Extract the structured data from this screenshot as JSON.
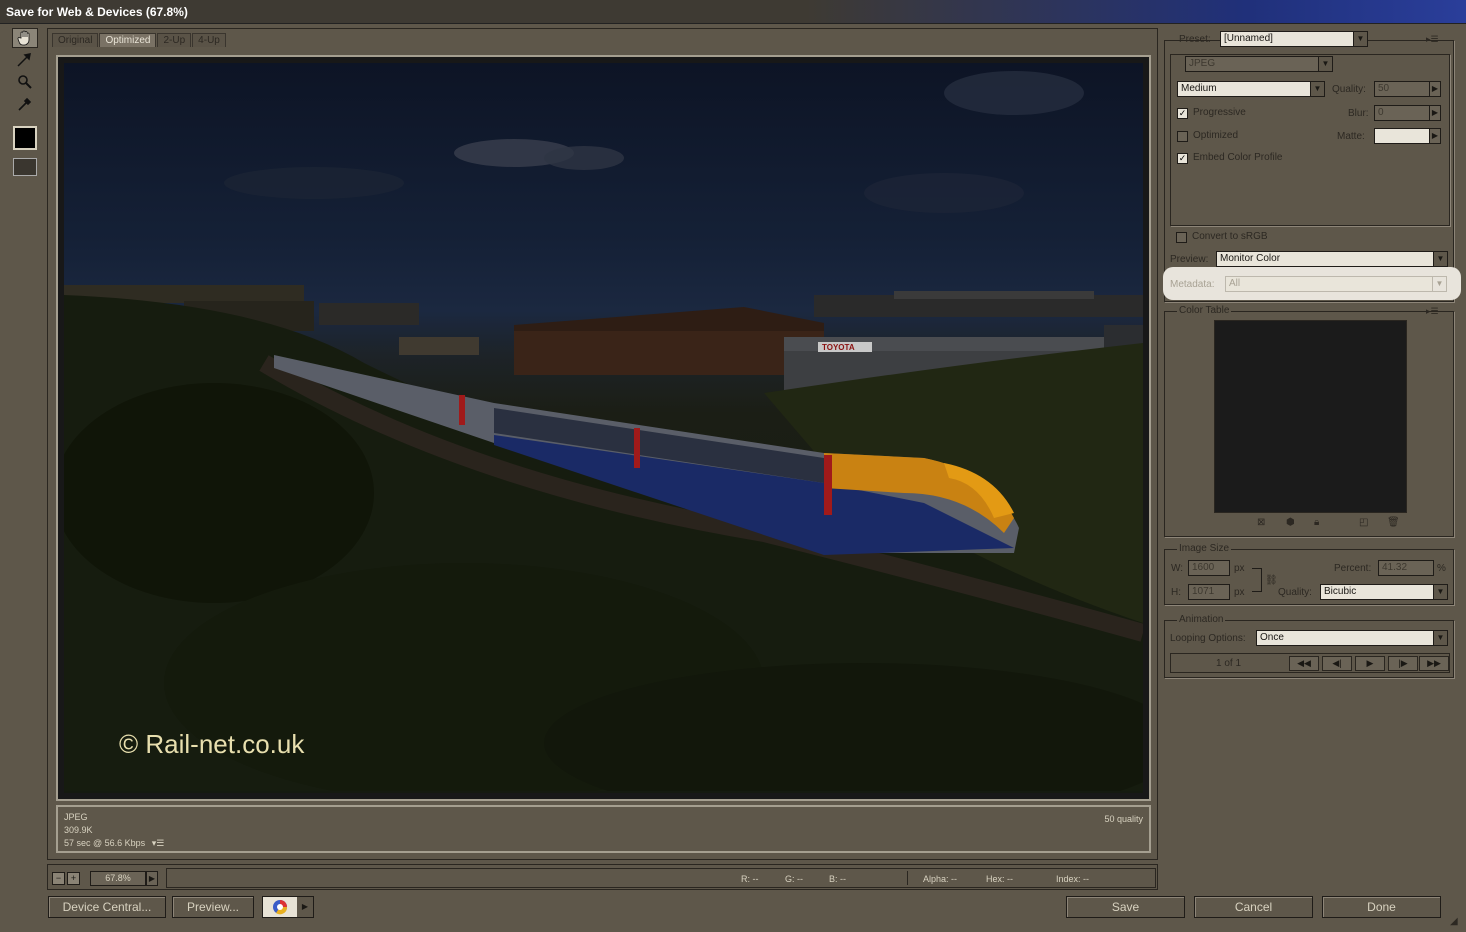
{
  "window": {
    "title": "Save for Web & Devices (67.8%)"
  },
  "tools": [
    {
      "name": "hand-tool-icon"
    },
    {
      "name": "slice-select-tool-icon"
    },
    {
      "name": "zoom-tool-icon"
    },
    {
      "name": "eyedropper-tool-icon"
    }
  ],
  "tabs": [
    "Original",
    "Optimized",
    "2-Up",
    "4-Up"
  ],
  "active_tab": "Optimized",
  "image": {
    "watermark": "© Rail-net.co.uk",
    "sign_text": "TOYOTA"
  },
  "info": {
    "format": "JPEG",
    "size": "309.9K",
    "time": "57 sec @ 56.6 Kbps",
    "quality": "50 quality"
  },
  "status": {
    "zoom": "67.8%",
    "r": "R: --",
    "g": "G: --",
    "b": "B: --",
    "alpha": "Alpha: --",
    "hex": "Hex: --",
    "index": "Index: --"
  },
  "buttons": {
    "device_central": "Device Central...",
    "preview": "Preview...",
    "save": "Save",
    "cancel": "Cancel",
    "done": "Done"
  },
  "settings": {
    "preset_label": "Preset:",
    "preset_value": "[Unnamed]",
    "format": "JPEG",
    "quality_level": "Medium",
    "quality_label": "Quality:",
    "quality_value": "50",
    "blur_label": "Blur:",
    "blur_value": "0",
    "matte_label": "Matte:",
    "progressive": "Progressive",
    "optimized": "Optimized",
    "embed_profile": "Embed Color Profile",
    "convert_srgb": "Convert to sRGB",
    "preview_label": "Preview:",
    "preview_value": "Monitor Color",
    "metadata_label": "Metadata:",
    "metadata_value": "All",
    "progressive_checked": true,
    "optimized_checked": false,
    "embed_checked": true,
    "srgb_checked": false
  },
  "color_table": {
    "label": "Color Table"
  },
  "image_size": {
    "label": "Image Size",
    "w_label": "W:",
    "w_value": "1600",
    "h_label": "H:",
    "h_value": "1071",
    "unit": "px",
    "percent_label": "Percent:",
    "percent_value": "41.32",
    "percent_unit": "%",
    "quality_label": "Quality:",
    "quality_value": "Bicubic"
  },
  "animation": {
    "label": "Animation",
    "looping_label": "Looping Options:",
    "looping_value": "Once",
    "frame": "1 of 1"
  }
}
